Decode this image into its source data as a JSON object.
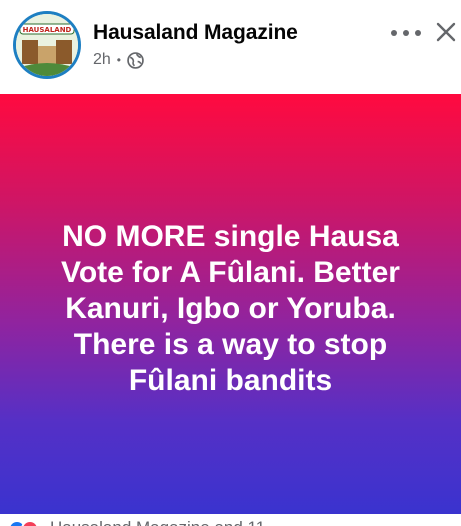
{
  "header": {
    "page_name": "Hausaland Magazine",
    "time": "2h",
    "separator": "•",
    "audience_icon": "globe-icon",
    "avatar_label": "HAUSALAND",
    "more_icon": "more-horizontal-icon",
    "close_icon": "close-icon"
  },
  "post": {
    "text_lines": [
      "NO MORE single Hausa",
      "Vote for A Fûlani. Better",
      "Kanuri, Igbo or Yoruba.",
      "There is a way to stop",
      "Fûlani bandits"
    ],
    "background_gradient": [
      "#ff0a3f",
      "#d01564",
      "#8f24a0",
      "#5530c6",
      "#3a33cf"
    ]
  },
  "reactions": {
    "icons": [
      "like-icon",
      "love-icon"
    ],
    "text": "Hausaland Magazine and 11"
  },
  "colors": {
    "text_primary": "#050505",
    "text_secondary": "#65676b",
    "avatar_ring": "#1e7fc2"
  }
}
